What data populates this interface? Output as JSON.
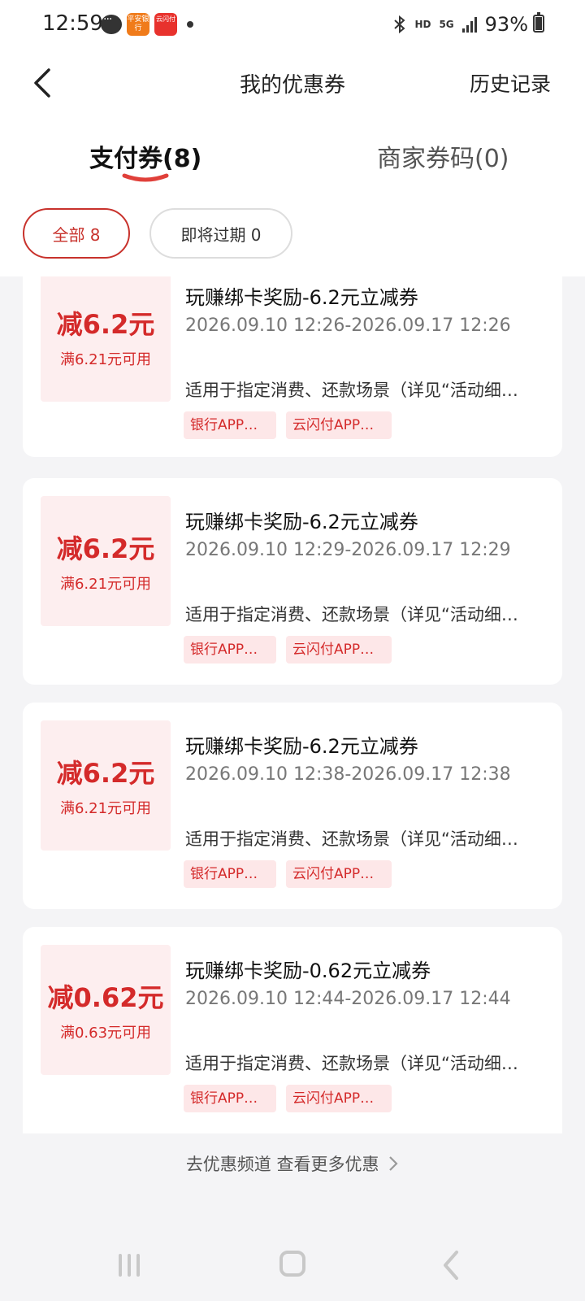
{
  "status_bar": {
    "time": "12:59",
    "notif_app1": "平安银行",
    "notif_app2": "云闪付",
    "hd": "HD",
    "net": "5G",
    "battery": "93%"
  },
  "header": {
    "title": "我的优惠券",
    "history": "历史记录"
  },
  "tabs": {
    "active": "支付券(8)",
    "inactive": "商家券码(0)"
  },
  "filters": {
    "all": "全部 8",
    "expiring": "即将过期 0"
  },
  "coupons": [
    {
      "amount": "减6.2元",
      "condition": "满6.21元可用",
      "title": "玩赚绑卡奖励-6.2元立减券",
      "date": "2026.09.10 12:26-2026.09.17 12:26",
      "desc": "适用于指定消费、还款场景（详见“活动细…",
      "tag1": "银行APP…",
      "tag2": "云闪付APP…"
    },
    {
      "amount": "减6.2元",
      "condition": "满6.21元可用",
      "title": "玩赚绑卡奖励-6.2元立减券",
      "date": "2026.09.10 12:29-2026.09.17 12:29",
      "desc": "适用于指定消费、还款场景（详见“活动细…",
      "tag1": "银行APP…",
      "tag2": "云闪付APP…"
    },
    {
      "amount": "减6.2元",
      "condition": "满6.21元可用",
      "title": "玩赚绑卡奖励-6.2元立减券",
      "date": "2026.09.10 12:38-2026.09.17 12:38",
      "desc": "适用于指定消费、还款场景（详见“活动细…",
      "tag1": "银行APP…",
      "tag2": "云闪付APP…"
    },
    {
      "amount": "减0.62元",
      "condition": "满0.63元可用",
      "title": "玩赚绑卡奖励-0.62元立减券",
      "date": "2026.09.10 12:44-2026.09.17 12:44",
      "desc": "适用于指定消费、还款场景（详见“活动细…",
      "tag1": "银行APP…",
      "tag2": "云闪付APP…"
    }
  ],
  "footer": {
    "more": "去优惠频道 查看更多优惠"
  },
  "colors": {
    "accent": "#d42a2a",
    "chip_border": "#c8322c",
    "amount_bg": "#fdeeef",
    "tag_bg": "#fde7e8"
  }
}
